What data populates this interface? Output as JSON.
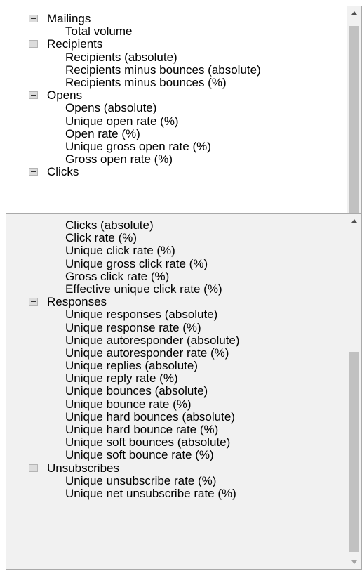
{
  "top_list": [
    {
      "label": "Mailings",
      "children": [
        "Total volume"
      ]
    },
    {
      "label": "Recipients",
      "children": [
        "Recipients (absolute)",
        "Recipients minus bounces (absolute)",
        "Recipients minus bounces (%)"
      ]
    },
    {
      "label": "Opens",
      "children": [
        "Opens (absolute)",
        "Unique open rate (%)",
        "Open rate (%)",
        "Unique gross open rate (%)",
        "Gross open rate (%)"
      ]
    },
    {
      "label": "Clicks",
      "children": []
    }
  ],
  "bottom_list": [
    {
      "label": "",
      "children": [
        "Clicks (absolute)",
        "Click rate (%)",
        "Unique click rate (%)",
        "Unique gross click rate (%)",
        "Gross click rate (%)",
        "Effective unique click rate (%)"
      ]
    },
    {
      "label": "Responses",
      "children": [
        "Unique responses (absolute)",
        "Unique response rate (%)",
        "Unique autoresponder (absolute)",
        "Unique autoresponder rate (%)",
        "Unique replies (absolute)",
        "Unique reply rate (%)",
        "Unique bounces (absolute)",
        "Unique bounce rate (%)",
        "Unique hard bounces (absolute)",
        "Unique hard bounce rate (%)",
        "Unique soft bounces (absolute)",
        "Unique soft bounce rate (%)"
      ]
    },
    {
      "label": "Unsubscribes",
      "children": [
        "Unique unsubscribe rate (%)",
        "Unique net unsubscribe rate (%)"
      ]
    }
  ],
  "icons": {
    "toggle": "collapse-minus-icon",
    "scroll_up": "scroll-up-arrow-icon",
    "scroll_down": "scroll-down-arrow-icon"
  }
}
